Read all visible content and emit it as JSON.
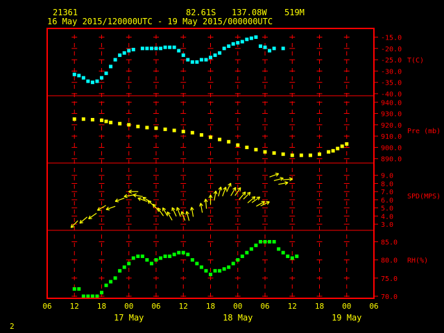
{
  "header": {
    "station": "21361",
    "lat": "82.61S",
    "lon": "137.08W",
    "elev": "519M",
    "period": "16 May 2015/120000UTC - 19 May 2015/000000UTC"
  },
  "footer": {
    "page_number": "2"
  },
  "colors": {
    "frame": "#ff0000",
    "grid": "#ff0000",
    "text": "#ffff00",
    "temp": "#00ffff",
    "pres": "#ffff00",
    "wind": "#ffff00",
    "rh": "#00ff00"
  },
  "chart_data": {
    "type": "scatter",
    "x_axis": {
      "unit": "hours since 16 May 2015 06:00 UTC",
      "range": [
        0,
        72
      ],
      "ticks": [
        {
          "x": 0,
          "label": "06"
        },
        {
          "x": 6,
          "label": "12"
        },
        {
          "x": 12,
          "label": "18"
        },
        {
          "x": 18,
          "label": "00"
        },
        {
          "x": 24,
          "label": "06"
        },
        {
          "x": 30,
          "label": "12"
        },
        {
          "x": 36,
          "label": "18"
        },
        {
          "x": 42,
          "label": "00"
        },
        {
          "x": 48,
          "label": "06"
        },
        {
          "x": 54,
          "label": "12"
        },
        {
          "x": 60,
          "label": "18"
        },
        {
          "x": 66,
          "label": "00"
        },
        {
          "x": 72,
          "label": "06"
        }
      ],
      "day_labels": [
        {
          "x": 18,
          "label": "17 May"
        },
        {
          "x": 42,
          "label": "18 May"
        },
        {
          "x": 66,
          "label": "19 May"
        }
      ]
    },
    "panels": [
      {
        "id": "temp",
        "label": "T(C)",
        "range": [
          -40,
          -13
        ],
        "ticks": [
          -15,
          -20,
          -25,
          -30,
          -35,
          -40
        ],
        "tick_labels": [
          "-15.0",
          "-20.0",
          "-25.0",
          "-30.0",
          "-35.0",
          "-40.0"
        ],
        "label_at": -25,
        "points": [
          [
            6,
            -31.5
          ],
          [
            7,
            -32
          ],
          [
            8,
            -33
          ],
          [
            9,
            -34.5
          ],
          [
            10,
            -35
          ],
          [
            11,
            -34.5
          ],
          [
            12,
            -33
          ],
          [
            13,
            -31
          ],
          [
            14,
            -28
          ],
          [
            15,
            -25
          ],
          [
            16,
            -23
          ],
          [
            17,
            -22
          ],
          [
            18,
            -21
          ],
          [
            19,
            -20.5
          ],
          [
            21,
            -20
          ],
          [
            22,
            -20
          ],
          [
            23,
            -20
          ],
          [
            24,
            -20
          ],
          [
            25,
            -20
          ],
          [
            26,
            -19.5
          ],
          [
            27,
            -19.5
          ],
          [
            28,
            -19.5
          ],
          [
            29,
            -21
          ],
          [
            30,
            -23
          ],
          [
            31,
            -25
          ],
          [
            32,
            -26
          ],
          [
            33,
            -26
          ],
          [
            34,
            -25
          ],
          [
            35,
            -25
          ],
          [
            36,
            -24
          ],
          [
            37,
            -23
          ],
          [
            38,
            -22
          ],
          [
            39,
            -20
          ],
          [
            40,
            -19
          ],
          [
            41,
            -18
          ],
          [
            42,
            -17.5
          ],
          [
            43,
            -17
          ],
          [
            44,
            -16
          ],
          [
            45,
            -15.5
          ],
          [
            46,
            -15
          ],
          [
            47,
            -19
          ],
          [
            48,
            -19.5
          ],
          [
            49,
            -21
          ],
          [
            50,
            -20
          ],
          [
            52,
            -20
          ]
        ]
      },
      {
        "id": "pres",
        "label": "Pre (mb)",
        "range": [
          888,
          942
        ],
        "ticks": [
          940,
          930,
          920,
          910,
          900,
          890
        ],
        "tick_labels": [
          "940.0",
          "930.0",
          "920.0",
          "910.0",
          "900.0",
          "890.0"
        ],
        "label_at": 915,
        "points": [
          [
            6,
            925
          ],
          [
            8,
            925
          ],
          [
            10,
            924.5
          ],
          [
            12,
            924
          ],
          [
            13,
            923
          ],
          [
            14,
            922
          ],
          [
            16,
            921
          ],
          [
            18,
            920
          ],
          [
            20,
            918.5
          ],
          [
            22,
            917.5
          ],
          [
            24,
            917
          ],
          [
            26,
            916
          ],
          [
            28,
            915
          ],
          [
            30,
            914
          ],
          [
            32,
            913
          ],
          [
            34,
            911
          ],
          [
            36,
            909
          ],
          [
            38,
            907
          ],
          [
            40,
            905
          ],
          [
            42,
            902
          ],
          [
            44,
            900
          ],
          [
            46,
            898
          ],
          [
            48,
            896
          ],
          [
            50,
            895
          ],
          [
            52,
            894
          ],
          [
            54,
            893
          ],
          [
            56,
            893
          ],
          [
            58,
            893
          ],
          [
            60,
            894
          ],
          [
            62,
            896
          ],
          [
            63,
            897
          ],
          [
            64,
            899
          ],
          [
            65,
            901
          ],
          [
            66,
            903
          ]
        ]
      },
      {
        "id": "wind",
        "label": "SPD(MPS)",
        "range": [
          2.5,
          10
        ],
        "ticks": [
          9,
          8,
          7,
          6,
          5,
          4,
          3
        ],
        "tick_labels": [
          "9.0",
          "8.0",
          "7.0",
          "6.0",
          "5.0",
          "4.0",
          "3.0"
        ],
        "label_at": 6.5,
        "points": [
          [
            6,
            3
          ],
          [
            8,
            3.5
          ],
          [
            10,
            4
          ],
          [
            12,
            5
          ],
          [
            14,
            5
          ],
          [
            16,
            6
          ],
          [
            18,
            6.5
          ],
          [
            19,
            7
          ],
          [
            20,
            6.5
          ],
          [
            21,
            6
          ],
          [
            22,
            6
          ],
          [
            23,
            5.5
          ],
          [
            24,
            5
          ],
          [
            25,
            4.5
          ],
          [
            26,
            4.5
          ],
          [
            27,
            4
          ],
          [
            28,
            4.5
          ],
          [
            29,
            4.5
          ],
          [
            30,
            4
          ],
          [
            31,
            4
          ],
          [
            32,
            4.5
          ],
          [
            34,
            5
          ],
          [
            35,
            5.5
          ],
          [
            36,
            6
          ],
          [
            37,
            6.5
          ],
          [
            38,
            7
          ],
          [
            39,
            7
          ],
          [
            40,
            7.5
          ],
          [
            41,
            7
          ],
          [
            42,
            7
          ],
          [
            43,
            6.5
          ],
          [
            44,
            6.5
          ],
          [
            45,
            6
          ],
          [
            46,
            6
          ],
          [
            47,
            5.5
          ],
          [
            48,
            5.5
          ],
          [
            50,
            9
          ],
          [
            51,
            8.5
          ],
          [
            52,
            8
          ],
          [
            53,
            8.5
          ]
        ],
        "directions_deg": [
          225,
          230,
          235,
          240,
          250,
          250,
          260,
          270,
          280,
          290,
          300,
          310,
          320,
          325,
          330,
          330,
          335,
          340,
          340,
          345,
          350,
          350,
          355,
          0,
          10,
          15,
          20,
          25,
          30,
          35,
          40,
          45,
          50,
          55,
          60,
          65,
          70,
          75,
          80,
          85
        ]
      },
      {
        "id": "rh",
        "label": "RH(%)",
        "range": [
          70,
          87
        ],
        "ticks": [
          85,
          80,
          75,
          70
        ],
        "tick_labels": [
          "85.0",
          "80.0",
          "75.0",
          "70.0"
        ],
        "label_at": 80,
        "points": [
          [
            6,
            72
          ],
          [
            7,
            72
          ],
          [
            8,
            70
          ],
          [
            9,
            70
          ],
          [
            10,
            70
          ],
          [
            11,
            70
          ],
          [
            12,
            71
          ],
          [
            13,
            73
          ],
          [
            14,
            74
          ],
          [
            15,
            75
          ],
          [
            16,
            77
          ],
          [
            17,
            78
          ],
          [
            18,
            79
          ],
          [
            19,
            80.5
          ],
          [
            20,
            81
          ],
          [
            21,
            81
          ],
          [
            22,
            80
          ],
          [
            23,
            79
          ],
          [
            24,
            80
          ],
          [
            25,
            80.5
          ],
          [
            26,
            81
          ],
          [
            27,
            81
          ],
          [
            28,
            81.5
          ],
          [
            29,
            82
          ],
          [
            30,
            82
          ],
          [
            31,
            81.5
          ],
          [
            32,
            80
          ],
          [
            33,
            79
          ],
          [
            34,
            78
          ],
          [
            35,
            77
          ],
          [
            36,
            76
          ],
          [
            37,
            77
          ],
          [
            38,
            77
          ],
          [
            39,
            77.5
          ],
          [
            40,
            78
          ],
          [
            41,
            79
          ],
          [
            42,
            80
          ],
          [
            43,
            81
          ],
          [
            44,
            82
          ],
          [
            45,
            83
          ],
          [
            46,
            84
          ],
          [
            47,
            85
          ],
          [
            48,
            85
          ],
          [
            49,
            85
          ],
          [
            50,
            85
          ],
          [
            51,
            83
          ],
          [
            52,
            82
          ],
          [
            53,
            81
          ],
          [
            54,
            80.5
          ],
          [
            55,
            81
          ]
        ]
      }
    ]
  }
}
